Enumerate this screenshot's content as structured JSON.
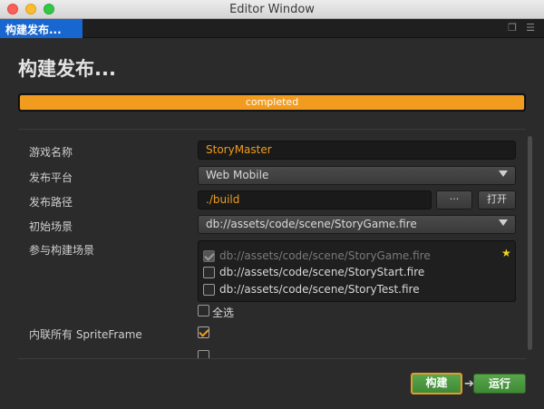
{
  "window": {
    "title": "Editor Window"
  },
  "tab": {
    "label": "构建发布..."
  },
  "header": {
    "title": "构建发布..."
  },
  "progress": {
    "percent": 100,
    "status": "completed"
  },
  "form": {
    "game_name": {
      "label": "游戏名称",
      "value": "StoryMaster"
    },
    "platform": {
      "label": "发布平台",
      "value": "Web Mobile"
    },
    "build_path": {
      "label": "发布路径",
      "value": "./build",
      "browse_label": "···",
      "open_label": "打开"
    },
    "start_scene": {
      "label": "初始场景",
      "value": "db://assets/code/scene/StoryGame.fire"
    },
    "included_scenes": {
      "label": "参与构建场景",
      "items": [
        {
          "path": "db://assets/code/scene/StoryGame.fire",
          "checked": true,
          "disabled": true,
          "starred": true
        },
        {
          "path": "db://assets/code/scene/StoryStart.fire",
          "checked": false
        },
        {
          "path": "db://assets/code/scene/StoryTest.fire",
          "checked": false
        }
      ],
      "select_all_label": "全选"
    },
    "inline_spriteframe": {
      "label": "内联所有 SpriteFrame",
      "checked": true
    }
  },
  "footer": {
    "build_label": "构建",
    "run_label": "运行"
  },
  "colors": {
    "accent": "#f19c1e",
    "tab": "#1866d0",
    "button_green": "#4a9a3f",
    "star": "#f5d623"
  },
  "icons": [
    "close-window-icon",
    "minimize-window-icon",
    "maximize-window-icon",
    "popout-icon",
    "panel-menu-icon",
    "dropdown-arrow-icon",
    "star-icon",
    "arrow-right-icon",
    "checkmark-icon"
  ]
}
